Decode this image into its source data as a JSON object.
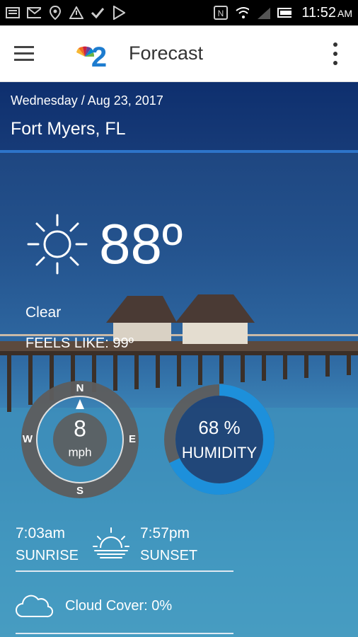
{
  "status_bar": {
    "time": "11:52",
    "ampm": "AM",
    "left_icons": [
      "message-icon",
      "gmail-icon",
      "location-icon",
      "alert-icon",
      "check-icon",
      "play-store-icon"
    ],
    "right_icons": [
      "nfc-icon",
      "wifi-icon",
      "signal-icon",
      "battery-icon"
    ]
  },
  "appbar": {
    "title": "Forecast",
    "logo_text": "2"
  },
  "header": {
    "date": "Wednesday / Aug 23, 2017",
    "city": "Fort Myers, FL"
  },
  "current": {
    "temperature": "88º",
    "condition": "Clear",
    "feels_like": "FEELS LIKE: 99º"
  },
  "wind": {
    "speed": "8",
    "unit": "mph",
    "n": "N",
    "s": "S",
    "e": "E",
    "w": "W",
    "direction_deg": 0
  },
  "humidity": {
    "value_text": "68 %",
    "label": "HUMIDITY",
    "fraction": 0.68
  },
  "sun": {
    "sunrise_time": "7:03am",
    "sunrise_label": "SUNRISE",
    "sunset_time": "7:57pm",
    "sunset_label": "SUNSET"
  },
  "cloud": {
    "label": "Cloud Cover: 0%"
  },
  "colors": {
    "accent": "#1d90db",
    "ring_dark": "#555555"
  }
}
